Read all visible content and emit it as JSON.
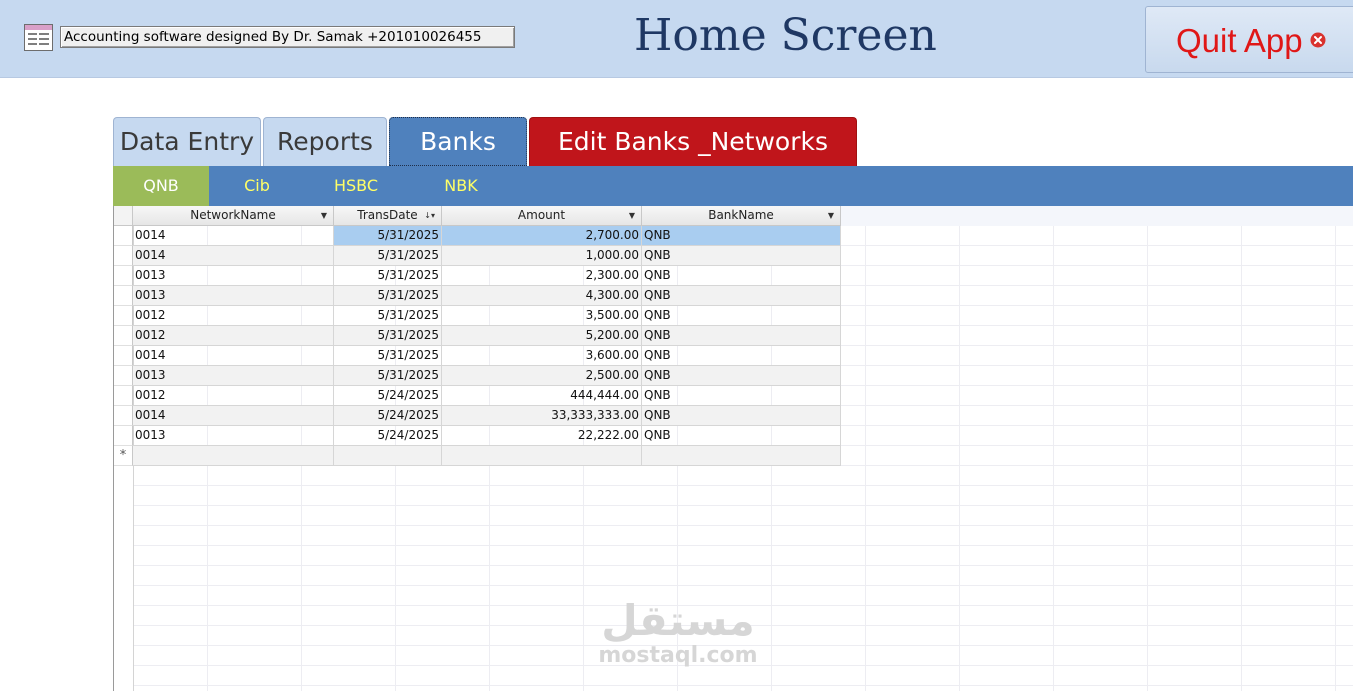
{
  "header": {
    "credit": "Accounting software designed By Dr. Samak +201010026455",
    "title": "Home Screen",
    "quit_label": "Quit App"
  },
  "tabs": [
    {
      "label": "Data Entry"
    },
    {
      "label": "Reports"
    },
    {
      "label": "Banks"
    },
    {
      "label": "Edit Banks _Networks"
    }
  ],
  "subtabs": [
    {
      "label": "QNB"
    },
    {
      "label": "Cib"
    },
    {
      "label": "HSBC"
    },
    {
      "label": "NBK"
    }
  ],
  "table": {
    "columns": [
      {
        "label": "NetworkName"
      },
      {
        "label": "TransDate"
      },
      {
        "label": "Amount"
      },
      {
        "label": "BankName"
      }
    ],
    "rows": [
      {
        "network": "0014",
        "date": "5/31/2025",
        "amount": "2,700.00",
        "bank": "QNB"
      },
      {
        "network": "0014",
        "date": "5/31/2025",
        "amount": "1,000.00",
        "bank": "QNB"
      },
      {
        "network": "0013",
        "date": "5/31/2025",
        "amount": "2,300.00",
        "bank": "QNB"
      },
      {
        "network": "0013",
        "date": "5/31/2025",
        "amount": "4,300.00",
        "bank": "QNB"
      },
      {
        "network": "0012",
        "date": "5/31/2025",
        "amount": "3,500.00",
        "bank": "QNB"
      },
      {
        "network": "0012",
        "date": "5/31/2025",
        "amount": "5,200.00",
        "bank": "QNB"
      },
      {
        "network": "0014",
        "date": "5/31/2025",
        "amount": "3,600.00",
        "bank": "QNB"
      },
      {
        "network": "0013",
        "date": "5/31/2025",
        "amount": "2,500.00",
        "bank": "QNB"
      },
      {
        "network": "0012",
        "date": "5/24/2025",
        "amount": "444,444.00",
        "bank": "QNB"
      },
      {
        "network": "0014",
        "date": "5/24/2025",
        "amount": "33,333,333.00",
        "bank": "QNB"
      },
      {
        "network": "0013",
        "date": "5/24/2025",
        "amount": "22,222.00",
        "bank": "QNB"
      }
    ],
    "new_row_marker": "*"
  },
  "watermark": {
    "arabic": "مستقل",
    "latin": "mostaql.com"
  },
  "colors": {
    "header_bg": "#c6d9f0",
    "tab_active": "#4f81bd",
    "tab_edit": "#c0151b",
    "subtab_active": "#9bbb59",
    "subtab_text": "#ffff66",
    "quit_text": "#e01717",
    "title_text": "#1f3864"
  },
  "icons": {
    "form": "form-icon",
    "quit": "close-circle-icon",
    "sort": "dropdown-arrow-icon"
  }
}
